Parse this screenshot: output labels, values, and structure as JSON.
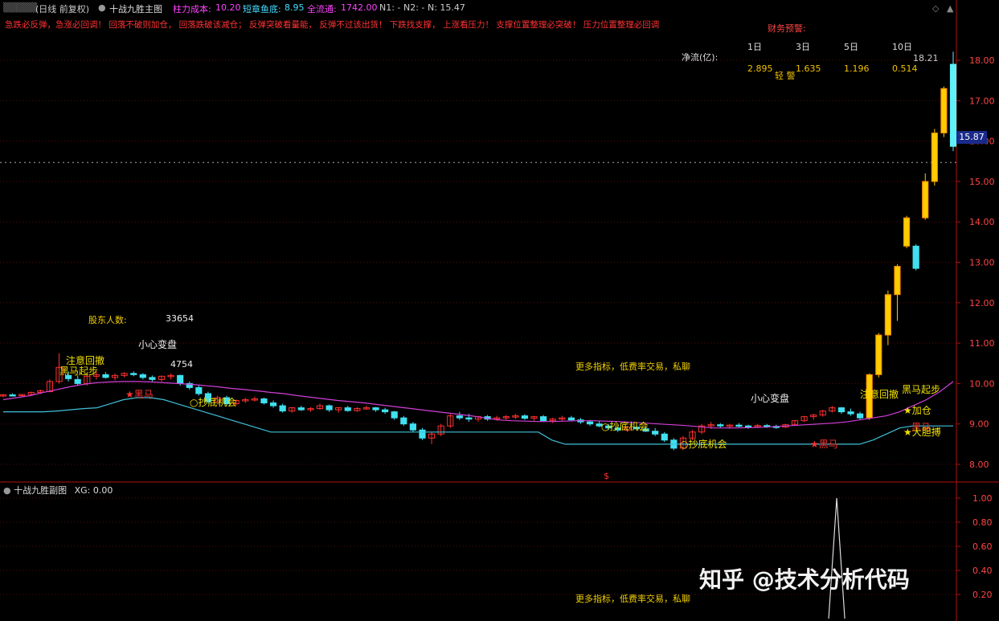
{
  "header": {
    "period": "(日线 前复权)",
    "indicator_name": "十战九胜主图",
    "cost_label": "柱力成本:",
    "cost_value": "10.20",
    "short_label": "短章鱼底:",
    "short_value": "8.95",
    "flow_label": "全流通:",
    "flow_value": "1742.00",
    "n1": "N1: -",
    "n2": "N2: -",
    "n": "N: 15.47"
  },
  "signals_text": "急跌必反弹，急涨必回调！ 回落不破则加仓， 回落跌破该减仓； 反弹突破看量能， 反弹不过该出货！ 下跌找支撑， 上涨看压力！ 支撑位置整理必突破！ 压力位置整理必回调",
  "finance": {
    "title": "财务预警:",
    "net_flow_label": "净流(亿):",
    "periods": [
      "1日",
      "3日",
      "5日",
      "10日"
    ],
    "values": [
      "2.895",
      "1.635",
      "1.196",
      "0.514"
    ],
    "warning": "轻 警"
  },
  "annotations": {
    "holders_label": "股东人数:",
    "holders_value": "33654",
    "caution1": "小心变盘",
    "caution1_value": "4754",
    "caution2": "小心变盘",
    "more1": "更多指标，低费率交易，私聊",
    "more2": "更多指标，低费率交易，私聊",
    "attention1": "注意回撤",
    "darkhorse_start1": "黑马起步",
    "darkhorse1": "黑马",
    "bottom1": "抄底机会",
    "bottom2": "抄底机会",
    "bottom3": "抄底机会",
    "darkhorse2": "黑马",
    "attention2": "注意回撤",
    "darkhorse_start2": "黑马起步",
    "add": "加仓",
    "bold": "大胆搏",
    "darkhorse3": "黑马",
    "s_mark": "$",
    "high_label": "18.21"
  },
  "price_tag": "15.87",
  "sub": {
    "title": "十战九胜副图",
    "xg": "XG: 0.00"
  },
  "watermark": "知乎 @技术分析代码",
  "chart_data": [
    {
      "type": "candlestick",
      "title": "十战九胜主图",
      "y_axis": {
        "ticks": [
          "8.00",
          "9.00",
          "10.00",
          "11.00",
          "12.00",
          "13.00",
          "14.00",
          "15.00",
          "16.00",
          "17.00",
          "18.00"
        ],
        "ylim": [
          7.6,
          18.4
        ]
      },
      "candles_ohlc": [
        [
          9.7,
          9.74,
          9.66,
          9.72
        ],
        [
          9.72,
          9.76,
          9.68,
          9.7
        ],
        [
          9.7,
          9.74,
          9.66,
          9.73
        ],
        [
          9.73,
          9.8,
          9.7,
          9.78
        ],
        [
          9.78,
          9.85,
          9.74,
          9.82
        ],
        [
          9.8,
          10.1,
          9.78,
          10.05
        ],
        [
          10.05,
          10.75,
          10.0,
          10.4
        ],
        [
          10.2,
          10.3,
          10.05,
          10.12
        ],
        [
          10.1,
          10.2,
          9.95,
          10.0
        ],
        [
          10.0,
          10.25,
          9.95,
          10.18
        ],
        [
          10.18,
          10.3,
          10.1,
          10.22
        ],
        [
          10.22,
          10.28,
          10.12,
          10.15
        ],
        [
          10.15,
          10.25,
          10.08,
          10.2
        ],
        [
          10.2,
          10.28,
          10.15,
          10.25
        ],
        [
          10.25,
          10.3,
          10.18,
          10.22
        ],
        [
          10.22,
          10.26,
          10.1,
          10.15
        ],
        [
          10.15,
          10.2,
          10.05,
          10.1
        ],
        [
          10.1,
          10.2,
          10.05,
          10.18
        ],
        [
          10.18,
          10.25,
          10.1,
          10.2
        ],
        [
          10.2,
          10.22,
          9.95,
          10.0
        ],
        [
          10.0,
          10.05,
          9.85,
          9.9
        ],
        [
          9.9,
          9.95,
          9.7,
          9.75
        ],
        [
          9.75,
          9.8,
          9.5,
          9.55
        ],
        [
          9.55,
          9.7,
          9.5,
          9.65
        ],
        [
          9.65,
          9.7,
          9.45,
          9.5
        ],
        [
          9.5,
          9.6,
          9.45,
          9.58
        ],
        [
          9.58,
          9.65,
          9.52,
          9.6
        ],
        [
          9.6,
          9.68,
          9.55,
          9.62
        ],
        [
          9.62,
          9.65,
          9.48,
          9.52
        ],
        [
          9.52,
          9.58,
          9.4,
          9.45
        ],
        [
          9.45,
          9.5,
          9.28,
          9.32
        ],
        [
          9.32,
          9.42,
          9.28,
          9.4
        ],
        [
          9.4,
          9.45,
          9.32,
          9.35
        ],
        [
          9.35,
          9.42,
          9.3,
          9.38
        ],
        [
          9.38,
          9.5,
          9.35,
          9.45
        ],
        [
          9.45,
          9.48,
          9.3,
          9.35
        ],
        [
          9.35,
          9.42,
          9.28,
          9.4
        ],
        [
          9.4,
          9.45,
          9.3,
          9.33
        ],
        [
          9.33,
          9.42,
          9.3,
          9.38
        ],
        [
          9.38,
          9.45,
          9.35,
          9.4
        ],
        [
          9.4,
          9.42,
          9.3,
          9.35
        ],
        [
          9.35,
          9.4,
          9.25,
          9.3
        ],
        [
          9.3,
          9.32,
          9.1,
          9.15
        ],
        [
          9.15,
          9.2,
          8.95,
          9.0
        ],
        [
          9.0,
          9.05,
          8.8,
          8.85
        ],
        [
          8.85,
          8.9,
          8.6,
          8.65
        ],
        [
          8.65,
          8.8,
          8.5,
          8.75
        ],
        [
          8.75,
          9.0,
          8.7,
          8.95
        ],
        [
          8.95,
          9.25,
          8.9,
          9.2
        ],
        [
          9.2,
          9.3,
          9.1,
          9.15
        ],
        [
          9.15,
          9.25,
          9.05,
          9.12
        ],
        [
          9.12,
          9.2,
          9.05,
          9.18
        ],
        [
          9.18,
          9.22,
          9.08,
          9.12
        ],
        [
          9.12,
          9.2,
          9.08,
          9.15
        ],
        [
          9.15,
          9.22,
          9.1,
          9.18
        ],
        [
          9.18,
          9.25,
          9.12,
          9.2
        ],
        [
          9.2,
          9.24,
          9.1,
          9.14
        ],
        [
          9.14,
          9.2,
          9.08,
          9.18
        ],
        [
          9.18,
          9.22,
          9.05,
          9.08
        ],
        [
          9.08,
          9.15,
          9.02,
          9.12
        ],
        [
          9.12,
          9.2,
          9.08,
          9.15
        ],
        [
          9.15,
          9.2,
          9.08,
          9.1
        ],
        [
          9.1,
          9.15,
          9.0,
          9.05
        ],
        [
          9.05,
          9.1,
          8.95,
          9.0
        ],
        [
          9.0,
          9.08,
          8.92,
          8.95
        ],
        [
          8.95,
          9.0,
          8.85,
          8.9
        ],
        [
          8.9,
          8.98,
          8.8,
          8.85
        ],
        [
          8.85,
          8.95,
          8.8,
          8.92
        ],
        [
          8.92,
          8.98,
          8.85,
          8.88
        ],
        [
          8.88,
          8.95,
          8.8,
          8.82
        ],
        [
          8.82,
          8.9,
          8.7,
          8.75
        ],
        [
          8.75,
          8.8,
          8.55,
          8.6
        ],
        [
          8.6,
          8.65,
          8.35,
          8.4
        ],
        [
          8.4,
          8.7,
          8.35,
          8.65
        ],
        [
          8.65,
          8.85,
          8.6,
          8.8
        ],
        [
          8.8,
          9.0,
          8.75,
          8.95
        ],
        [
          8.95,
          9.05,
          8.88,
          8.98
        ],
        [
          8.98,
          9.02,
          8.9,
          8.95
        ],
        [
          8.95,
          9.0,
          8.88,
          8.97
        ],
        [
          8.97,
          9.02,
          8.92,
          8.95
        ],
        [
          8.95,
          8.98,
          8.88,
          8.93
        ],
        [
          8.93,
          9.0,
          8.9,
          8.96
        ],
        [
          8.96,
          9.0,
          8.9,
          8.94
        ],
        [
          8.94,
          8.98,
          8.88,
          8.92
        ],
        [
          8.92,
          9.0,
          8.9,
          8.98
        ],
        [
          8.98,
          9.1,
          8.95,
          9.08
        ],
        [
          9.08,
          9.2,
          9.05,
          9.18
        ],
        [
          9.18,
          9.25,
          9.1,
          9.22
        ],
        [
          9.22,
          9.35,
          9.18,
          9.32
        ],
        [
          9.32,
          9.45,
          9.28,
          9.4
        ],
        [
          9.4,
          9.42,
          9.25,
          9.3
        ],
        [
          9.3,
          9.38,
          9.2,
          9.25
        ],
        [
          9.25,
          9.3,
          9.1,
          9.15
        ],
        [
          9.15,
          10.25,
          9.1,
          10.22
        ],
        [
          10.22,
          11.25,
          10.15,
          11.2
        ],
        [
          11.2,
          12.3,
          10.95,
          12.2
        ],
        [
          12.2,
          12.95,
          11.55,
          12.9
        ],
        [
          13.4,
          14.15,
          13.35,
          14.1
        ],
        [
          13.4,
          13.45,
          12.8,
          12.85
        ],
        [
          14.1,
          15.2,
          14.05,
          15.0
        ],
        [
          15.0,
          16.3,
          14.9,
          16.2
        ],
        [
          16.2,
          17.35,
          16.1,
          17.3
        ],
        [
          17.9,
          18.21,
          15.75,
          15.87
        ]
      ],
      "ma_purple": [
        9.6,
        9.65,
        9.7,
        9.78,
        9.85,
        9.92,
        9.98,
        10.02,
        10.04,
        10.05,
        10.05,
        10.04,
        10.02,
        10.0,
        9.98,
        9.95,
        9.92,
        9.88,
        9.85,
        9.82,
        9.78,
        9.75,
        9.7,
        9.66,
        9.62,
        9.58,
        9.55,
        9.52,
        9.48,
        9.44,
        9.4,
        9.36,
        9.32,
        9.28,
        9.24,
        9.2,
        9.15,
        9.1,
        9.08,
        9.07,
        9.06,
        9.06,
        9.07,
        9.08,
        9.08,
        9.07,
        9.06,
        9.04,
        9.02,
        9.0,
        8.98,
        8.96,
        8.93,
        8.9,
        8.9,
        8.9,
        8.91,
        8.92,
        8.94,
        8.96,
        8.98,
        9.0,
        9.02,
        9.05,
        9.1,
        9.15,
        9.2,
        9.3,
        9.45,
        9.6,
        9.8,
        10.05
      ],
      "ma_cyan": [
        9.3,
        9.3,
        9.3,
        9.3,
        9.32,
        9.35,
        9.38,
        9.4,
        9.5,
        9.6,
        9.65,
        9.65,
        9.6,
        9.5,
        9.4,
        9.3,
        9.2,
        9.1,
        9.0,
        8.9,
        8.8,
        8.8,
        8.8,
        8.8,
        8.8,
        8.8,
        8.8,
        8.8,
        8.8,
        8.8,
        8.8,
        8.8,
        8.8,
        8.8,
        8.8,
        8.8,
        8.8,
        8.8,
        8.8,
        8.8,
        8.8,
        8.6,
        8.5,
        8.5,
        8.5,
        8.5,
        8.5,
        8.5,
        8.5,
        8.5,
        8.5,
        8.5,
        8.5,
        8.5,
        8.5,
        8.5,
        8.5,
        8.5,
        8.5,
        8.5,
        8.5,
        8.5,
        8.5,
        8.5,
        8.5,
        8.6,
        8.75,
        8.9,
        8.95,
        8.95,
        8.95,
        8.95
      ]
    },
    {
      "type": "line",
      "title": "十战九胜副图",
      "y_axis": {
        "ticks": [
          "0.20",
          "0.40",
          "0.60",
          "0.80",
          "1.00"
        ],
        "ylim": [
          0,
          1.05
        ]
      },
      "series": [
        {
          "name": "XG",
          "values_spike": {
            "index_fraction": 0.962,
            "peak": 1.0
          }
        }
      ]
    }
  ]
}
